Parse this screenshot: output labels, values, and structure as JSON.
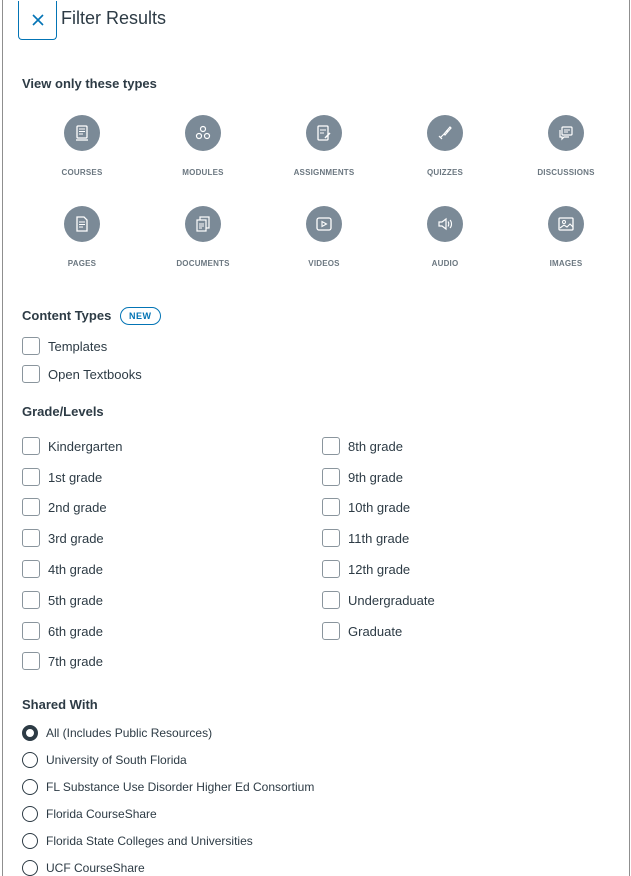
{
  "header": {
    "title": "Filter Results"
  },
  "types_section": {
    "title": "View only these types",
    "items": [
      {
        "label": "COURSES",
        "icon": "courses-icon"
      },
      {
        "label": "MODULES",
        "icon": "modules-icon"
      },
      {
        "label": "ASSIGNMENTS",
        "icon": "assignments-icon"
      },
      {
        "label": "QUIZZES",
        "icon": "quizzes-icon"
      },
      {
        "label": "DISCUSSIONS",
        "icon": "discussions-icon"
      },
      {
        "label": "PAGES",
        "icon": "pages-icon"
      },
      {
        "label": "DOCUMENTS",
        "icon": "documents-icon"
      },
      {
        "label": "VIDEOS",
        "icon": "videos-icon"
      },
      {
        "label": "AUDIO",
        "icon": "audio-icon"
      },
      {
        "label": "IMAGES",
        "icon": "images-icon"
      }
    ]
  },
  "content_types": {
    "title": "Content Types",
    "badge": "NEW",
    "options": [
      "Templates",
      "Open Textbooks"
    ]
  },
  "grade_levels": {
    "title": "Grade/Levels",
    "left": [
      "Kindergarten",
      "1st grade",
      "2nd grade",
      "3rd grade",
      "4th grade",
      "5th grade",
      "6th grade",
      "7th grade"
    ],
    "right": [
      "8th grade",
      "9th grade",
      "10th grade",
      "11th grade",
      "12th grade",
      "Undergraduate",
      "Graduate"
    ]
  },
  "shared_with": {
    "title": "Shared With",
    "options": [
      {
        "label": "All (Includes Public Resources)",
        "selected": true
      },
      {
        "label": "University of South Florida",
        "selected": false
      },
      {
        "label": "FL Substance Use Disorder Higher Ed Consortium",
        "selected": false
      },
      {
        "label": "Florida CourseShare",
        "selected": false
      },
      {
        "label": "Florida State Colleges and Universities",
        "selected": false
      },
      {
        "label": "UCF CourseShare",
        "selected": false
      }
    ]
  },
  "colors": {
    "accent": "#0374b5",
    "icon_bg": "#7b8a97",
    "text": "#2d3b45"
  }
}
